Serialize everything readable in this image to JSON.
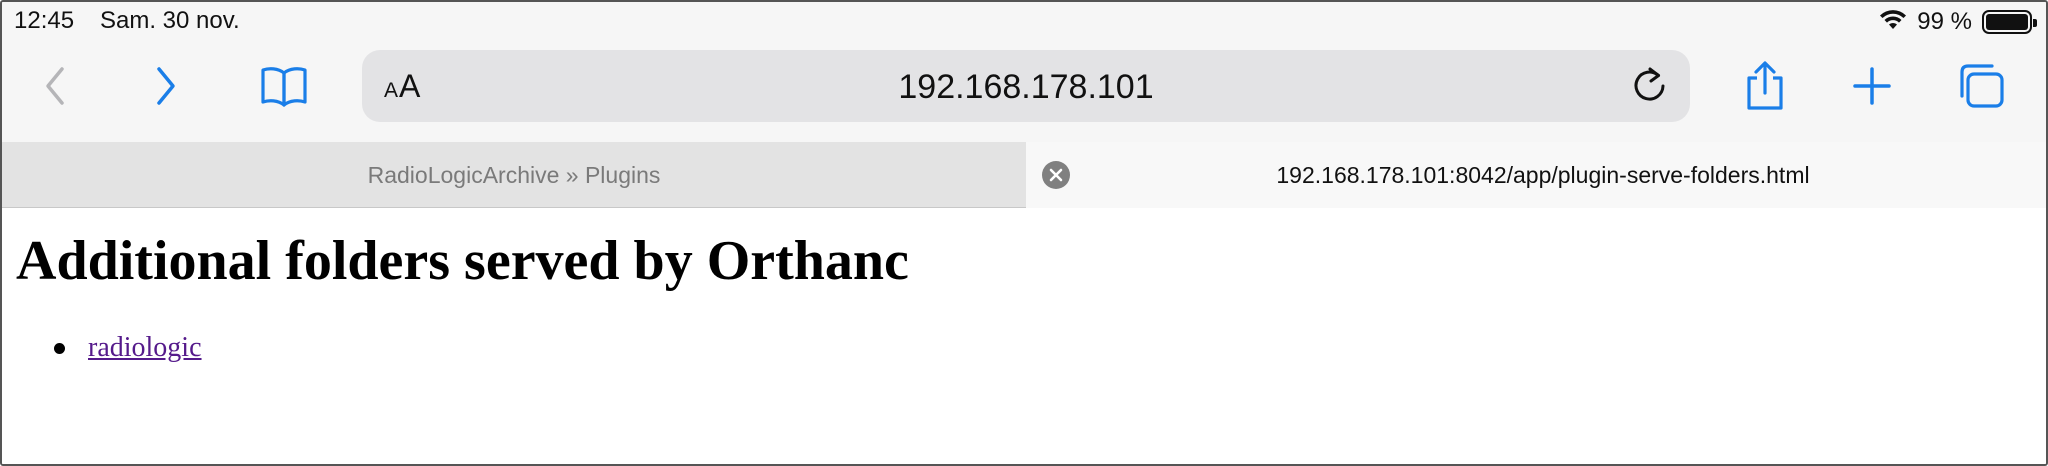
{
  "status_bar": {
    "time": "12:45",
    "date": "Sam. 30 nov.",
    "battery_text": "99 %"
  },
  "toolbar": {
    "aa_small": "A",
    "aa_large": "A",
    "url": "192.168.178.101",
    "icons": [
      "chevron-left-icon",
      "chevron-right-icon",
      "book-icon",
      "reload-icon",
      "share-icon",
      "plus-icon",
      "tabs-icon"
    ],
    "accent_color": "#1a7ee8",
    "disabled_color": "#b5b5b8"
  },
  "tabs": [
    {
      "label": "RadioLogicArchive » Plugins",
      "active": false
    },
    {
      "label": "192.168.178.101:8042/app/plugin-serve-folders.html",
      "active": true
    }
  ],
  "page": {
    "title": "Additional folders served by Orthanc",
    "folders": [
      {
        "label": "radiologic",
        "visited_color": "#551a8b"
      }
    ]
  }
}
